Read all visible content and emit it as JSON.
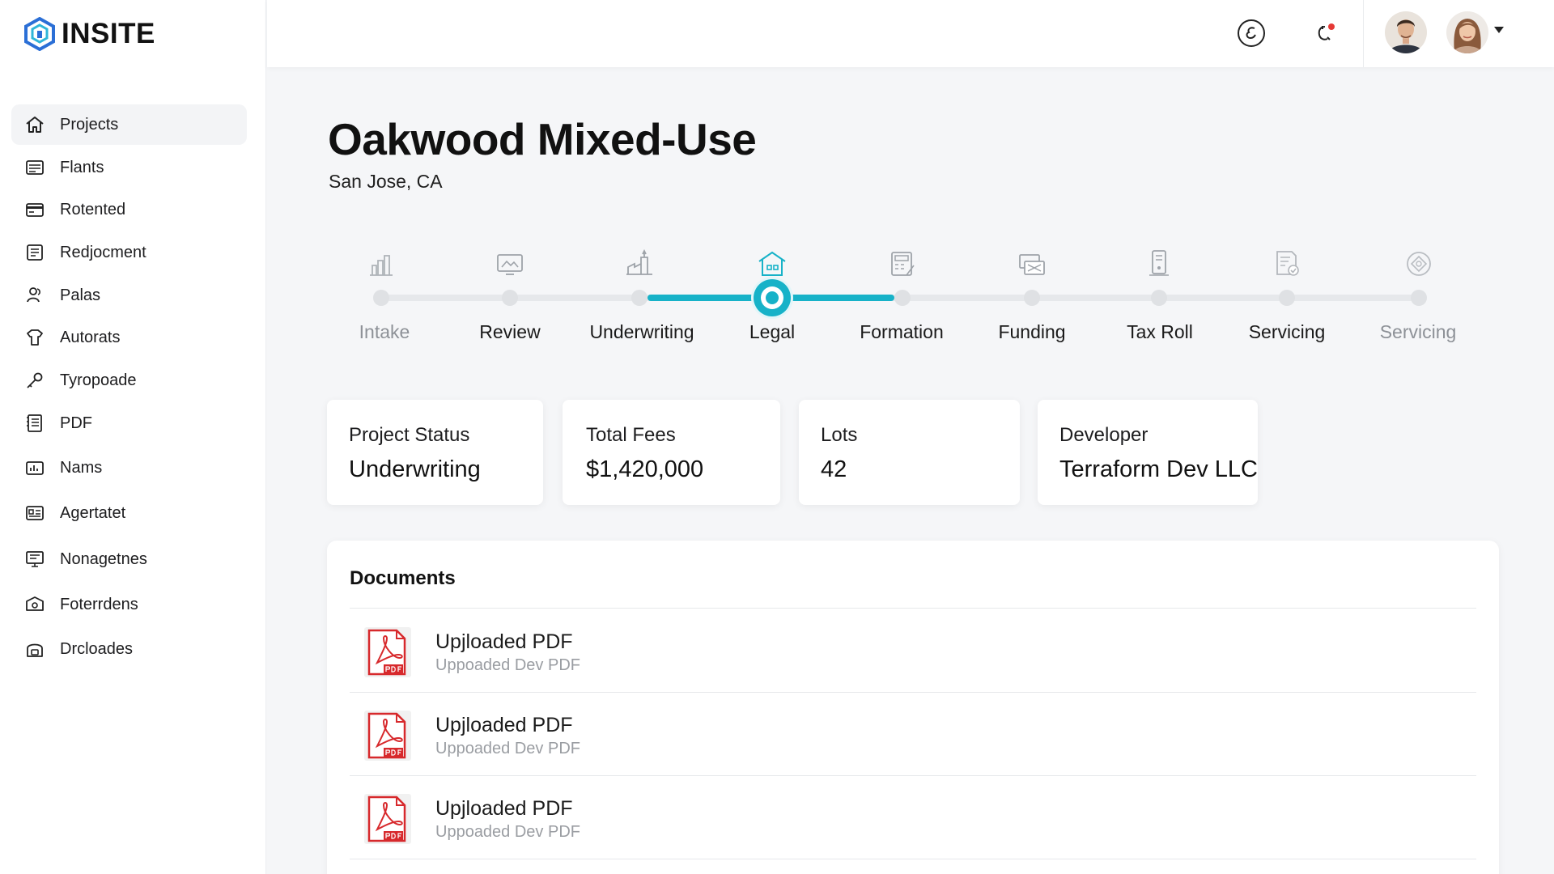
{
  "app": {
    "name": "INSITE"
  },
  "sidebar": {
    "items": [
      {
        "label": "Projects",
        "icon": "home-icon",
        "active": true
      },
      {
        "label": "Flants",
        "icon": "list-icon"
      },
      {
        "label": "Rotented",
        "icon": "card-icon"
      },
      {
        "label": "Redjocment",
        "icon": "document-icon"
      },
      {
        "label": "Palas",
        "icon": "users-icon"
      },
      {
        "label": "Autorats",
        "icon": "shirt-icon"
      },
      {
        "label": "Tyropoade",
        "icon": "key-icon"
      },
      {
        "label": "PDF",
        "icon": "notebook-icon"
      },
      {
        "label": "Nams",
        "icon": "chart-box-icon"
      },
      {
        "label": "Agertatet",
        "icon": "id-card-icon"
      },
      {
        "label": "Nonagetnes",
        "icon": "monitor-icon"
      },
      {
        "label": "Foterrdens",
        "icon": "box-icon"
      },
      {
        "label": "Drcloades",
        "icon": "lock-icon"
      }
    ]
  },
  "topbar": {
    "icons": [
      "chat-icon",
      "phone-notification-icon"
    ],
    "notification_color": "#e53935",
    "avatars": [
      "user-avatar-male",
      "user-avatar-female"
    ]
  },
  "project": {
    "title": "Oakwood Mixed-Use",
    "location": "San Jose, CA"
  },
  "stepper": {
    "accent": "#17b2c8",
    "current_index": 3,
    "steps": [
      {
        "label": "Intake",
        "icon": "building-chart-icon",
        "muted": true
      },
      {
        "label": "Review",
        "icon": "screen-icon"
      },
      {
        "label": "Underwriting",
        "icon": "factory-icon"
      },
      {
        "label": "Legal",
        "icon": "house-icon",
        "current": true
      },
      {
        "label": "Formation",
        "icon": "calculator-icon"
      },
      {
        "label": "Funding",
        "icon": "money-stack-icon"
      },
      {
        "label": "Tax Roll",
        "icon": "mobile-icon"
      },
      {
        "label": "Servicing",
        "icon": "document-check-icon"
      },
      {
        "label": "Servicing",
        "icon": "diamond-icon",
        "muted": true
      }
    ]
  },
  "stats": [
    {
      "label": "Project Status",
      "value": "Underwriting"
    },
    {
      "label": "Total Fees",
      "value": "$1,420,000"
    },
    {
      "label": "Lots",
      "value": "42"
    },
    {
      "label": "Developer",
      "value": "Terraform Dev LLC"
    }
  ],
  "documents": {
    "title": "Documents",
    "items": [
      {
        "name": "Upjloaded PDF",
        "sub": "Uppoaded Dev PDF",
        "icon": "pdf-file-icon"
      },
      {
        "name": "Upjloaded PDF",
        "sub": "Uppoaded Dev PDF",
        "icon": "pdf-file-icon"
      },
      {
        "name": "Upjloaded PDF",
        "sub": "Uppoaded Dev PDF",
        "icon": "pdf-file-icon"
      }
    ]
  }
}
